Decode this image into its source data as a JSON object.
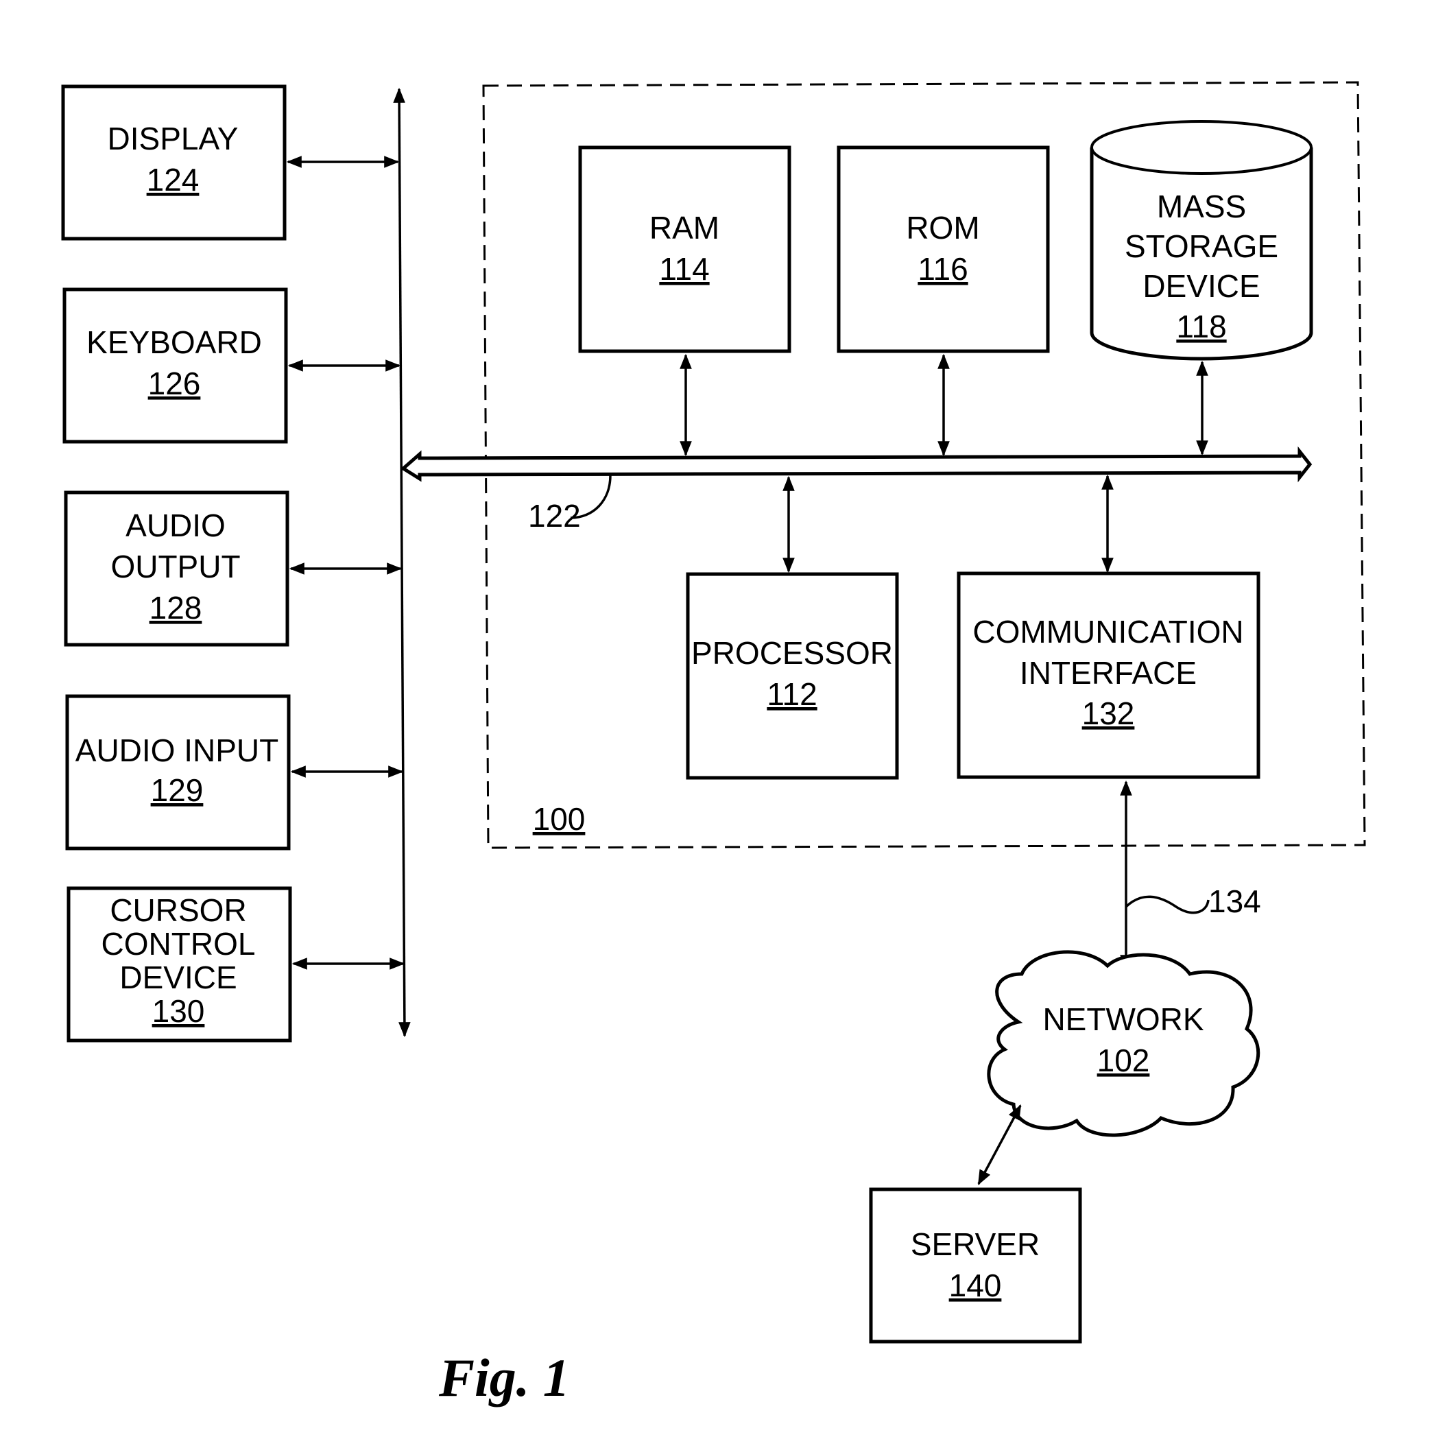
{
  "figure": {
    "caption": "Fig. 1"
  },
  "system": {
    "ref": "100",
    "bus_ref": "122",
    "link_ref": "134"
  },
  "peripherals": [
    {
      "id": "display",
      "lines": [
        "DISPLAY"
      ],
      "ref": "124"
    },
    {
      "id": "keyboard",
      "lines": [
        "KEYBOARD"
      ],
      "ref": "126"
    },
    {
      "id": "audio-output",
      "lines": [
        "AUDIO",
        "OUTPUT"
      ],
      "ref": "128"
    },
    {
      "id": "audio-input",
      "lines": [
        "AUDIO INPUT"
      ],
      "ref": "129"
    },
    {
      "id": "cursor-control-device",
      "lines": [
        "CURSOR",
        "CONTROL",
        "DEVICE"
      ],
      "ref": "130"
    }
  ],
  "components": {
    "ram": {
      "lines": [
        "RAM"
      ],
      "ref": "114"
    },
    "rom": {
      "lines": [
        "ROM"
      ],
      "ref": "116"
    },
    "mass_storage": {
      "lines": [
        "MASS",
        "STORAGE",
        "DEVICE"
      ],
      "ref": "118"
    },
    "processor": {
      "lines": [
        "PROCESSOR"
      ],
      "ref": "112"
    },
    "comm_interface": {
      "lines": [
        "COMMUNICATION",
        "INTERFACE"
      ],
      "ref": "132"
    },
    "network": {
      "lines": [
        "NETWORK"
      ],
      "ref": "102"
    },
    "server": {
      "lines": [
        "SERVER"
      ],
      "ref": "140"
    }
  }
}
